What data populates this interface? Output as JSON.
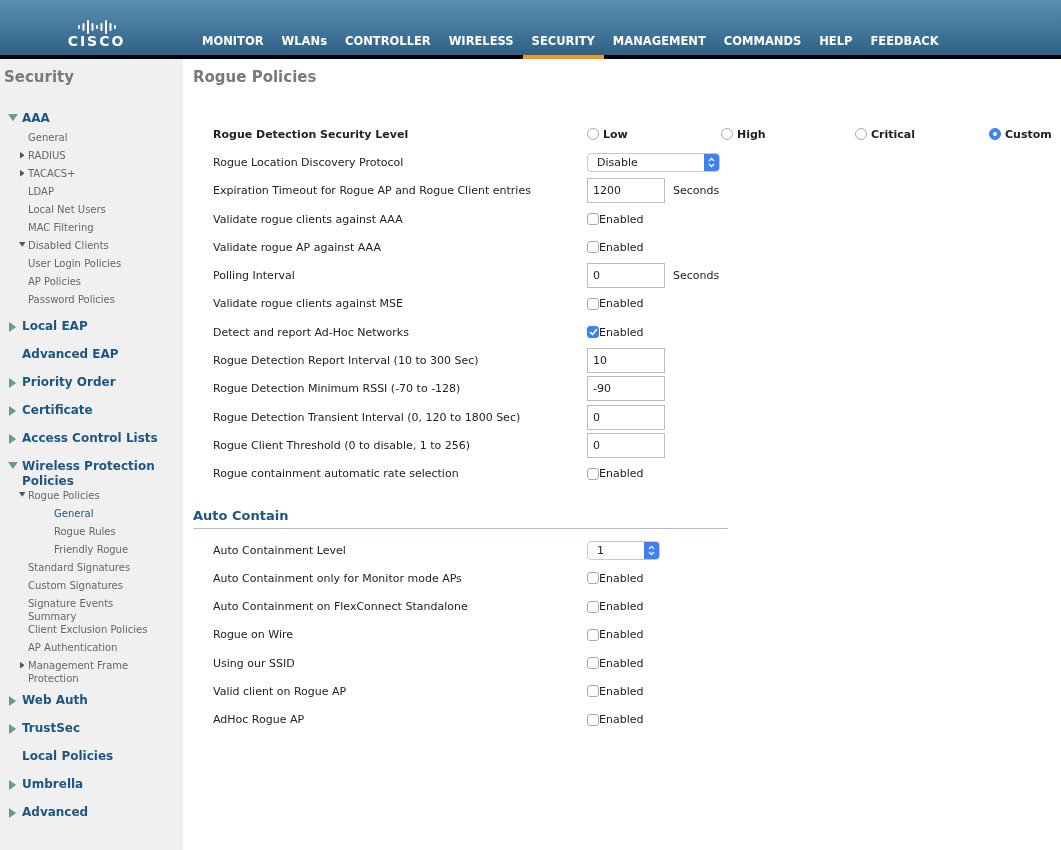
{
  "logo": {
    "text": "CISCO"
  },
  "nav": [
    {
      "label": "MONITOR",
      "selected": false
    },
    {
      "label": "WLANs",
      "selected": false
    },
    {
      "label": "CONTROLLER",
      "selected": false
    },
    {
      "label": "WIRELESS",
      "selected": false
    },
    {
      "label": "SECURITY",
      "selected": true
    },
    {
      "label": "MANAGEMENT",
      "selected": false
    },
    {
      "label": "COMMANDS",
      "selected": false
    },
    {
      "label": "HELP",
      "selected": false
    },
    {
      "label": "FEEDBACK",
      "selected": false
    }
  ],
  "sidebar": {
    "title": "Security",
    "items": [
      {
        "label": "AAA",
        "expanded": true,
        "selected": false,
        "children": [
          {
            "label": "General",
            "selected": false
          },
          {
            "label": "RADIUS",
            "expanded": false,
            "selected": false
          },
          {
            "label": "TACACS+",
            "expanded": false,
            "selected": false
          },
          {
            "label": "LDAP",
            "selected": false
          },
          {
            "label": "Local Net Users",
            "selected": false
          },
          {
            "label": "MAC Filtering",
            "selected": false
          },
          {
            "label": "Disabled Clients",
            "expanded": true,
            "selected": false
          },
          {
            "label": "User Login Policies",
            "selected": false
          },
          {
            "label": "AP Policies",
            "selected": false
          },
          {
            "label": "Password Policies",
            "selected": false
          }
        ]
      },
      {
        "label": "Local EAP",
        "expanded": false,
        "selected": false
      },
      {
        "label": "Advanced EAP",
        "selected": false
      },
      {
        "label": "Priority Order",
        "expanded": false,
        "selected": false
      },
      {
        "label": "Certificate",
        "expanded": false,
        "selected": false
      },
      {
        "label": "Access Control Lists",
        "expanded": false,
        "selected": false
      },
      {
        "label": "Wireless Protection Policies",
        "expanded": true,
        "selected": false,
        "children": [
          {
            "label": "Rogue Policies",
            "expanded": true,
            "selected": false,
            "children": [
              {
                "label": "General",
                "selected": true
              },
              {
                "label": "Rogue Rules",
                "selected": false
              },
              {
                "label": "Friendly Rogue",
                "selected": false
              }
            ]
          },
          {
            "label": "Standard Signatures",
            "selected": false
          },
          {
            "label": "Custom Signatures",
            "selected": false
          },
          {
            "label": "Signature Events Summary",
            "selected": false
          },
          {
            "label": "Client Exclusion Policies",
            "selected": false
          },
          {
            "label": "AP Authentication",
            "selected": false
          },
          {
            "label": "Management Frame Protection",
            "expanded": false,
            "selected": false
          }
        ]
      },
      {
        "label": "Web Auth",
        "expanded": false,
        "selected": false
      },
      {
        "label": "TrustSec",
        "expanded": false,
        "selected": false
      },
      {
        "label": "Local Policies",
        "selected": false
      },
      {
        "label": "Umbrella",
        "expanded": false,
        "selected": false
      },
      {
        "label": "Advanced",
        "expanded": false,
        "selected": false
      }
    ]
  },
  "page": {
    "title": "Rogue Policies",
    "sections": [
      {
        "rows": [
          {
            "kind": "radio",
            "label": "Rogue Detection Security Level",
            "options": [
              {
                "label": "Low",
                "selected": false
              },
              {
                "label": "High",
                "selected": false
              },
              {
                "label": "Critical",
                "selected": false
              },
              {
                "label": "Custom",
                "selected": true
              }
            ]
          },
          {
            "kind": "select",
            "label": "Rogue Location Discovery Protocol",
            "value": "Disable"
          },
          {
            "kind": "text",
            "label": "Expiration Timeout for Rogue AP and Rogue Client entries",
            "value": "1200",
            "unit": "Seconds"
          },
          {
            "kind": "checkbox",
            "label": "Validate rogue clients against AAA",
            "text": "Enabled",
            "checked": false
          },
          {
            "kind": "checkbox",
            "label": "Validate rogue AP against AAA",
            "text": "Enabled",
            "checked": false
          },
          {
            "kind": "text",
            "label": "Polling Interval",
            "value": "0",
            "unit": "Seconds"
          },
          {
            "kind": "checkbox",
            "label": "Validate rogue clients against MSE",
            "text": "Enabled",
            "checked": false
          },
          {
            "kind": "checkbox",
            "label": "Detect and report Ad-Hoc Networks",
            "text": "Enabled",
            "checked": true
          },
          {
            "kind": "text",
            "label": "Rogue Detection Report Interval (10 to 300 Sec)",
            "value": "10"
          },
          {
            "kind": "text",
            "label": "Rogue Detection Minimum RSSI (-70 to -128)",
            "value": "-90"
          },
          {
            "kind": "text",
            "label": "Rogue Detection Transient Interval (0, 120 to 1800 Sec)",
            "value": "0"
          },
          {
            "kind": "text",
            "label": "Rogue Client Threshold (0 to disable, 1 to 256)",
            "value": "0"
          },
          {
            "kind": "checkbox",
            "label": "Rogue containment automatic rate selection",
            "text": "Enabled",
            "checked": false
          }
        ]
      },
      {
        "heading": "Auto Contain",
        "rows": [
          {
            "kind": "select",
            "label": "Auto Containment Level",
            "value": "1"
          },
          {
            "kind": "checkbox",
            "label": "Auto Containment only for Monitor mode APs",
            "text": "Enabled",
            "checked": false
          },
          {
            "kind": "checkbox",
            "label": "Auto Containment on FlexConnect Standalone",
            "text": "Enabled",
            "checked": false
          },
          {
            "kind": "checkbox",
            "label": "Rogue on Wire",
            "text": "Enabled",
            "checked": false
          },
          {
            "kind": "checkbox",
            "label": "Using our SSID",
            "text": "Enabled",
            "checked": false
          },
          {
            "kind": "checkbox",
            "label": "Valid client on Rogue AP",
            "text": "Enabled",
            "checked": false
          },
          {
            "kind": "checkbox",
            "label": "AdHoc Rogue AP",
            "text": "Enabled",
            "checked": false
          }
        ]
      }
    ]
  }
}
